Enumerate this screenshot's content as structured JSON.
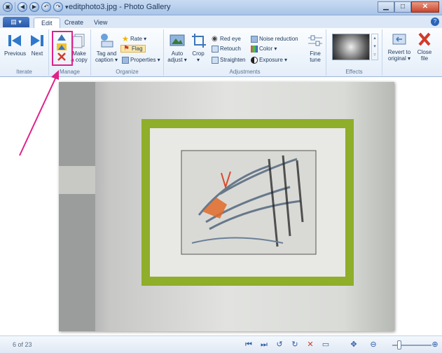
{
  "window": {
    "title": "editphoto3.jpg - Photo Gallery"
  },
  "tabs": {
    "file": "▾",
    "edit": "Edit",
    "create": "Create",
    "view": "View"
  },
  "ribbon": {
    "iterate": {
      "label": "Iterate",
      "previous": "Previous",
      "next": "Next"
    },
    "manage": {
      "label": "Manage",
      "make_copy": "Make\na copy"
    },
    "organize": {
      "label": "Organize",
      "tag_caption": "Tag and\ncaption ▾",
      "rate": "Rate ▾",
      "flag": "Flag",
      "properties": "Properties ▾"
    },
    "adjustments": {
      "label": "Adjustments",
      "auto_adjust": "Auto\nadjust ▾",
      "crop": "Crop\n▾",
      "red_eye": "Red eye",
      "retouch": "Retouch",
      "straighten": "Straighten",
      "noise": "Noise reduction",
      "color": "Color ▾",
      "exposure": "Exposure ▾",
      "fine_tune": "Fine\ntune"
    },
    "effects": {
      "label": "Effects"
    },
    "revert": "Revert to\noriginal ▾",
    "close_file": "Close\nfile"
  },
  "status": {
    "count": "6 of 23"
  },
  "colors": {
    "frame": "#8fae2a",
    "highlight": "#e0218a",
    "ribbon_blue": "#2b5aa6"
  }
}
